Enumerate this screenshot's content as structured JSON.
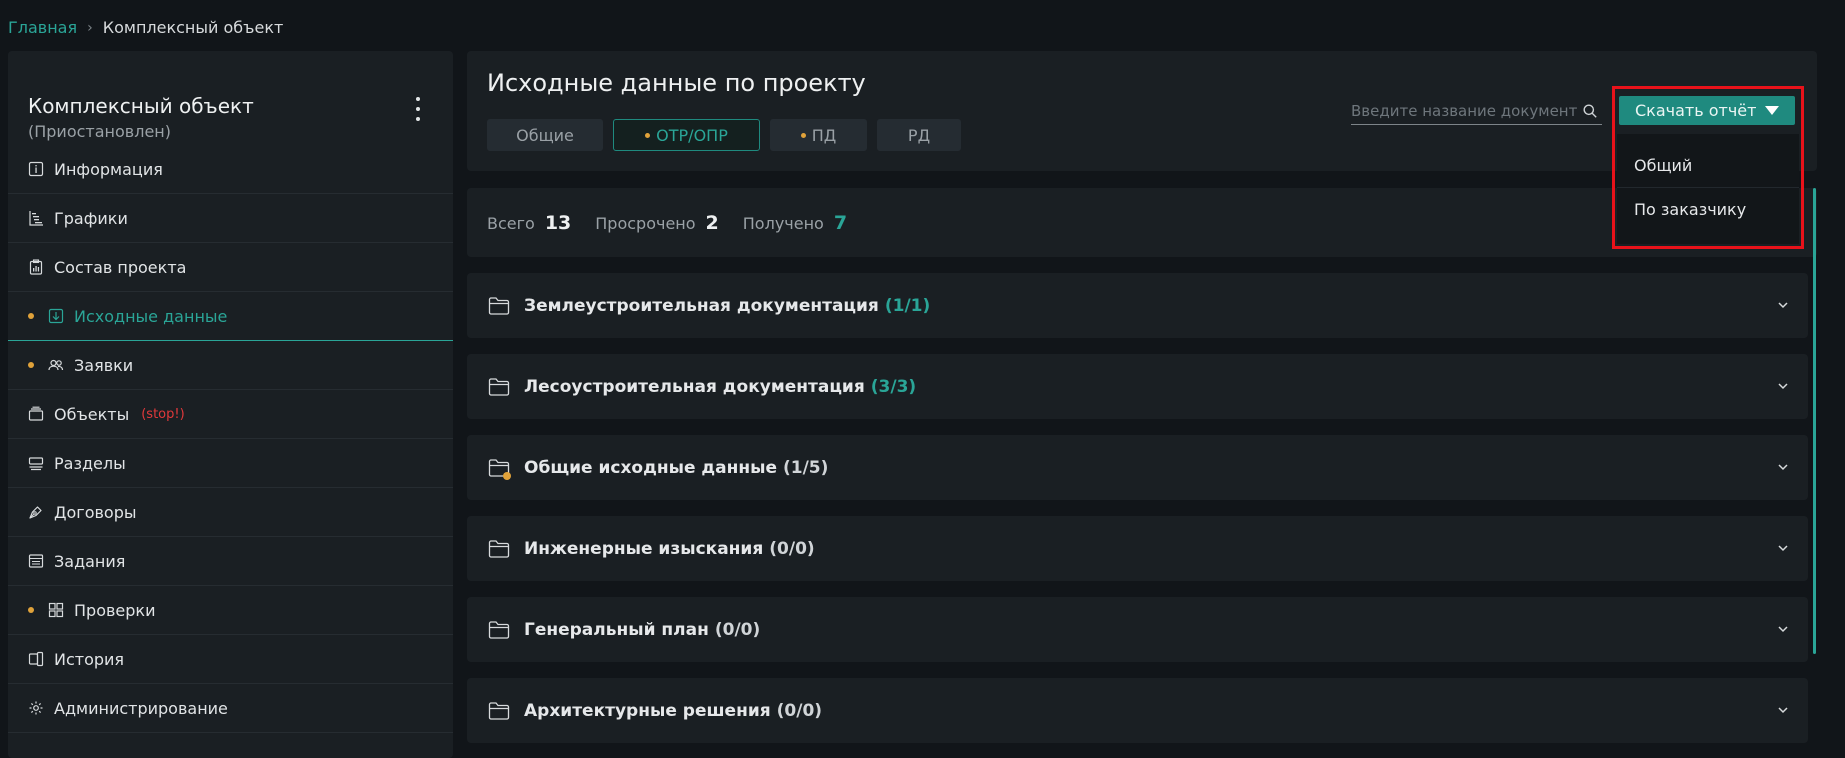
{
  "breadcrumb": {
    "home": "Главная",
    "separator": "›",
    "current": "Комплексный объект"
  },
  "sidebar": {
    "title": "Комплексный объект",
    "subtitle": "(Приостановлен)",
    "items": [
      {
        "label": "Информация",
        "icon": "info-icon",
        "dot": false,
        "active": false
      },
      {
        "label": "Графики",
        "icon": "gantt-icon",
        "dot": false,
        "active": false
      },
      {
        "label": "Состав проекта",
        "icon": "clipboard-chart-icon",
        "dot": false,
        "active": false
      },
      {
        "label": "Исходные данные",
        "icon": "download-box-icon",
        "dot": true,
        "active": true
      },
      {
        "label": "Заявки",
        "icon": "users-icon",
        "dot": true,
        "active": false
      },
      {
        "label": "Объекты",
        "icon": "folder-stack-icon",
        "dot": false,
        "active": false,
        "tag": "(stop!)"
      },
      {
        "label": "Разделы",
        "icon": "sections-icon",
        "dot": false,
        "active": false
      },
      {
        "label": "Договоры",
        "icon": "pen-icon",
        "dot": false,
        "active": false
      },
      {
        "label": "Задания",
        "icon": "window-icon",
        "dot": false,
        "active": false
      },
      {
        "label": "Проверки",
        "icon": "grid-icon",
        "dot": true,
        "active": false
      },
      {
        "label": "История",
        "icon": "history-icon",
        "dot": false,
        "active": false
      },
      {
        "label": "Администрирование",
        "icon": "gear-icon",
        "dot": false,
        "active": false
      }
    ]
  },
  "main": {
    "title": "Исходные данные по проекту",
    "tabs": [
      {
        "label": "Общие",
        "dot": false,
        "active": false
      },
      {
        "label": "ОТР/ОПР",
        "dot": true,
        "active": true
      },
      {
        "label": "ПД",
        "dot": true,
        "active": false
      },
      {
        "label": "РД",
        "dot": false,
        "active": false
      }
    ],
    "search_placeholder": "Введите название документа",
    "download_label": "Скачать отчёт",
    "dropdown": [
      "Общий",
      "По заказчику"
    ]
  },
  "stats": {
    "total_label": "Всего",
    "total_value": "13",
    "overdue_label": "Просрочено",
    "overdue_value": "2",
    "received_label": "Получено",
    "received_value": "7"
  },
  "sections": [
    {
      "title": "Землеустроительная документация",
      "count": "(1/1)",
      "complete": true,
      "dot": false
    },
    {
      "title": "Лесоустроительная документация",
      "count": "(3/3)",
      "complete": true,
      "dot": false
    },
    {
      "title": "Общие исходные данные",
      "count": "(1/5)",
      "complete": false,
      "dot": true
    },
    {
      "title": "Инженерные изыскания",
      "count": "(0/0)",
      "complete": false,
      "dot": false
    },
    {
      "title": "Генеральный план",
      "count": "(0/0)",
      "complete": false,
      "dot": false
    },
    {
      "title": "Архитектурные решения",
      "count": "(0/0)",
      "complete": false,
      "dot": false
    }
  ],
  "colors": {
    "accent": "#2aa597",
    "dot": "#e0a23a",
    "stop": "#e0393b",
    "highlight": "#e8121a"
  }
}
